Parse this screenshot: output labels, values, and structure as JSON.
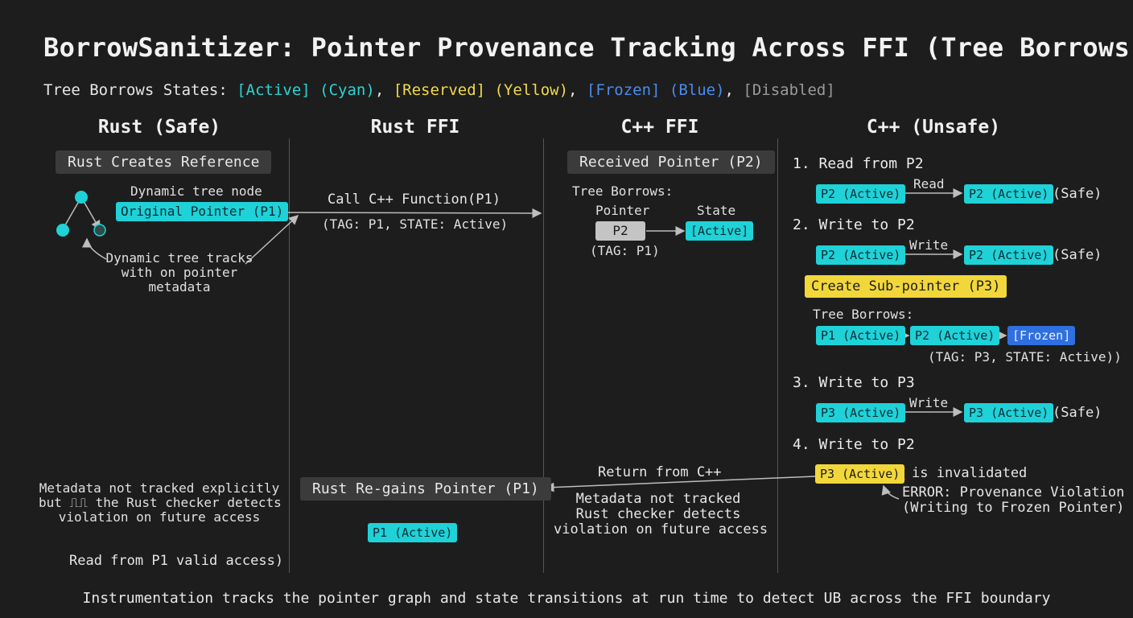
{
  "title": "BorrowSanitizer: Pointer Provenance Tracking Across FFI (Tree Borrows)",
  "legend": {
    "prefix": "Tree Borrows States: ",
    "active": "[Active] (Cyan)",
    "reserved": "[Reserved] (Yellow)",
    "frozen": "[Frozen] (Blue)",
    "disabled": "[Disabled]",
    "sep": ", "
  },
  "columns": [
    "Rust (Safe)",
    "Rust FFI",
    "C++ FFI",
    "C++ (Unsafe)"
  ],
  "rust_safe": {
    "header_box": "Rust Creates Reference",
    "node_label": "Dynamic tree node",
    "original_pointer": "Original Pointer (P1)",
    "tracks_note": [
      "Dynamic tree tracks",
      "with on pointer",
      "metadata"
    ],
    "bottom_note": [
      "Metadata  not tracked explicitly",
      "but ⎍⎍ the Rust checker detects",
      "violation on future access"
    ],
    "read_valid": "Read from P1 valid access)"
  },
  "rust_ffi": {
    "call_label": "Call C++ Function(P1)",
    "call_tag": "(TAG: P1, STATE: Active)",
    "regain_box": "Rust Re-gains Pointer (P1)",
    "p1_active": "P1 (Active)"
  },
  "cpp_ffi": {
    "received_box": "Received Pointer (P2)",
    "tree_borrows": "Tree Borrows:",
    "pointer_label": "Pointer",
    "state_label": "State",
    "p2": "P2",
    "active_state": "[Active]",
    "tag": "(TAG: P1)",
    "return_label": "Return from C++",
    "return_note": [
      "Metadata not tracked",
      "Rust checker detects",
      "violation on future access"
    ]
  },
  "cpp_unsafe": {
    "step1": "1. Read from P2",
    "step1_op": "Read",
    "step1_from": "P2 (Active)",
    "step1_to": "P2 (Active)",
    "step2": "2. Write to P2",
    "step2_op": "Write",
    "step2_from": "P2 (Active)",
    "step2_to": "P2 (Active)",
    "safe": "(Safe)",
    "sub_pointer_box": "Create Sub-pointer (P3)",
    "tree_borrows": "Tree Borrows:",
    "tree_p1": "P1 (Active)",
    "tree_p2": "P2 (Active)",
    "tree_frozen": "[Frozen]",
    "tree_tag": "(TAG: P3, STATE: Active))",
    "step3": "3. Write to P3",
    "step3_op": "Write",
    "step3_from": "P3 (Active)",
    "step3_to": "P3 (Active)",
    "step4": "4. Write to P2",
    "step4_chip": "P3 (Active)",
    "invalidated": "is invalidated",
    "error_lines": [
      "ERROR: Provenance Violation",
      "(Writing to Frozen Pointer)"
    ]
  },
  "footer": "Instrumentation tracks the pointer graph and state transitions at run time to detect UB across the FFI boundary",
  "colors": {
    "background": "#1d1d1d",
    "cyan": "#1ed2d8",
    "yellow": "#f2d73a",
    "blue": "#2f6fe0",
    "error": "#e8752a"
  }
}
